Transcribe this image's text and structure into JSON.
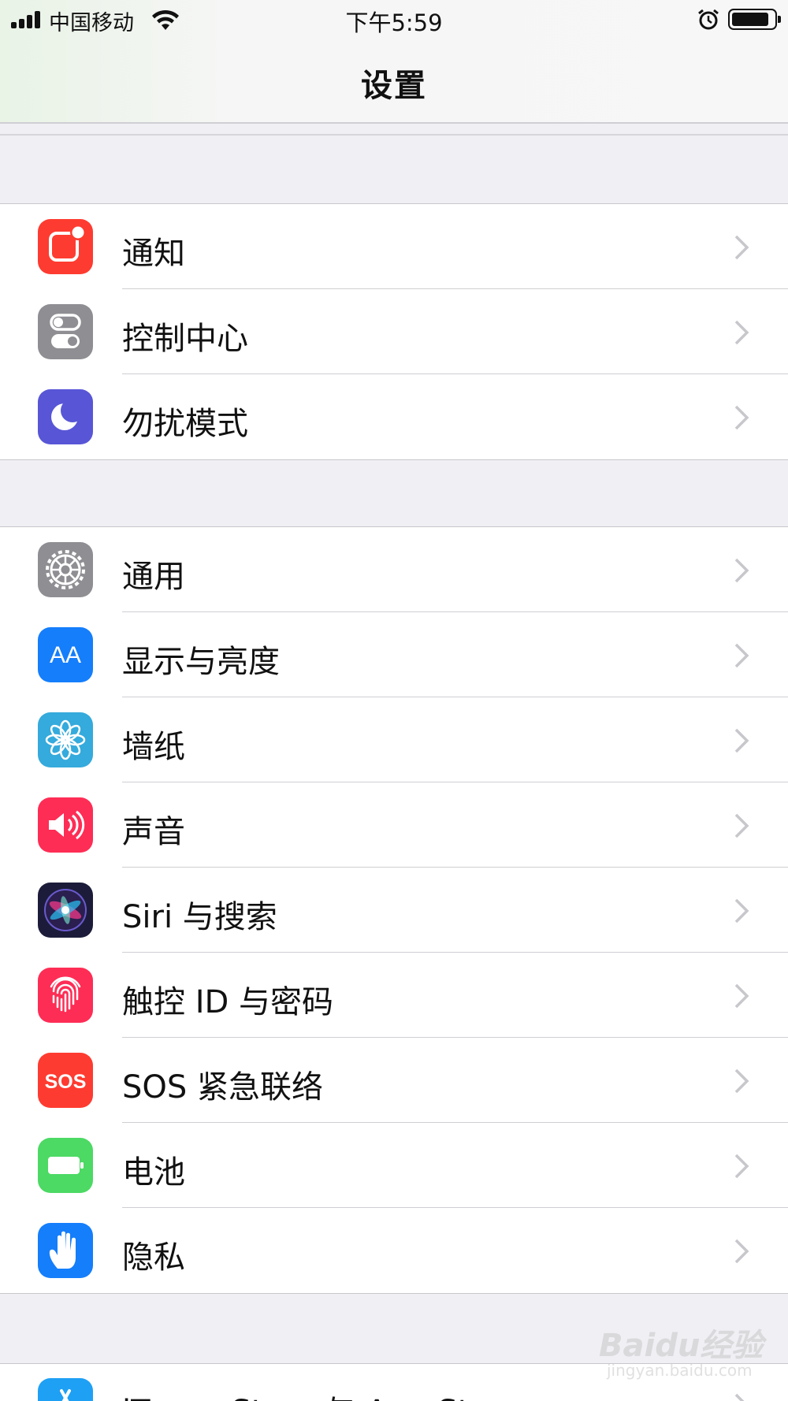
{
  "status_bar": {
    "carrier": "中国移动",
    "time": "下午5:59"
  },
  "nav": {
    "title": "设置"
  },
  "groups": [
    {
      "items": [
        {
          "label": "通知",
          "icon": "notifications-icon",
          "color": "#fe3b30"
        },
        {
          "label": "控制中心",
          "icon": "control-center-icon",
          "color": "#8e8e93"
        },
        {
          "label": "勿扰模式",
          "icon": "moon-icon",
          "color": "#5856d6"
        }
      ]
    },
    {
      "items": [
        {
          "label": "通用",
          "icon": "gear-icon",
          "color": "#8e8e93"
        },
        {
          "label": "显示与亮度",
          "icon": "display-brightness-icon",
          "color": "#157efb"
        },
        {
          "label": "墙纸",
          "icon": "wallpaper-flower-icon",
          "color": "#35aadc"
        },
        {
          "label": "声音",
          "icon": "speaker-icon",
          "color": "#fe2d55"
        },
        {
          "label": "Siri 与搜索",
          "icon": "siri-icon",
          "color": "#1c1c3a"
        },
        {
          "label": "触控 ID 与密码",
          "icon": "fingerprint-icon",
          "color": "#fe2d55"
        },
        {
          "label": "SOS 紧急联络",
          "icon": "sos-icon",
          "color": "#fe3b30"
        },
        {
          "label": "电池",
          "icon": "battery-icon",
          "color": "#4cd964"
        },
        {
          "label": "隐私",
          "icon": "hand-icon",
          "color": "#157efb"
        }
      ]
    },
    {
      "items": [
        {
          "label": "iTunes Store 与 App Store",
          "icon": "app-store-icon",
          "color": "#1ea0f5"
        }
      ]
    }
  ],
  "icon_texts": {
    "display": "AA",
    "sos": "SOS"
  },
  "watermark": {
    "brand": "Baidu经验",
    "url": "jingyan.baidu.com"
  }
}
